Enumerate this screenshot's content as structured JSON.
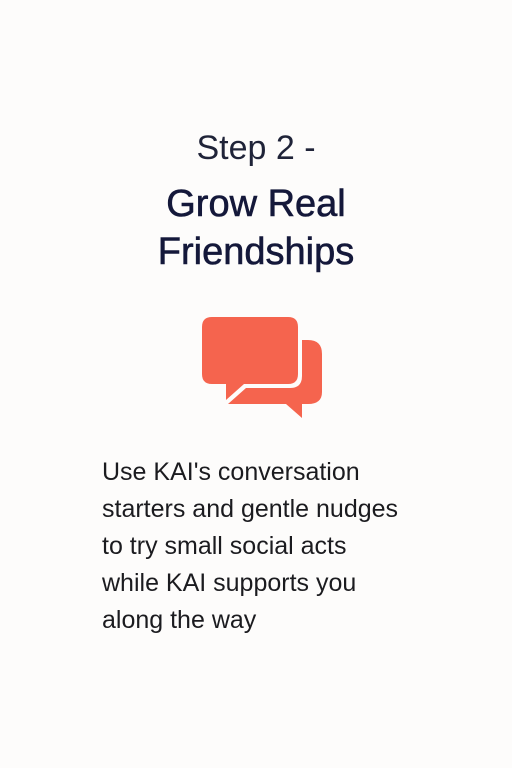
{
  "header": {
    "step_label": "Step 2 -",
    "title_line1": "Grow Real",
    "title_line2": "Friendships"
  },
  "icon": {
    "name": "chat-bubbles-icon",
    "color": "#f5644e"
  },
  "body": {
    "lines": [
      "Use KAI's conversation",
      "starters and gentle nudges",
      "to try small social acts",
      "while KAI supports you",
      "along the way"
    ]
  }
}
